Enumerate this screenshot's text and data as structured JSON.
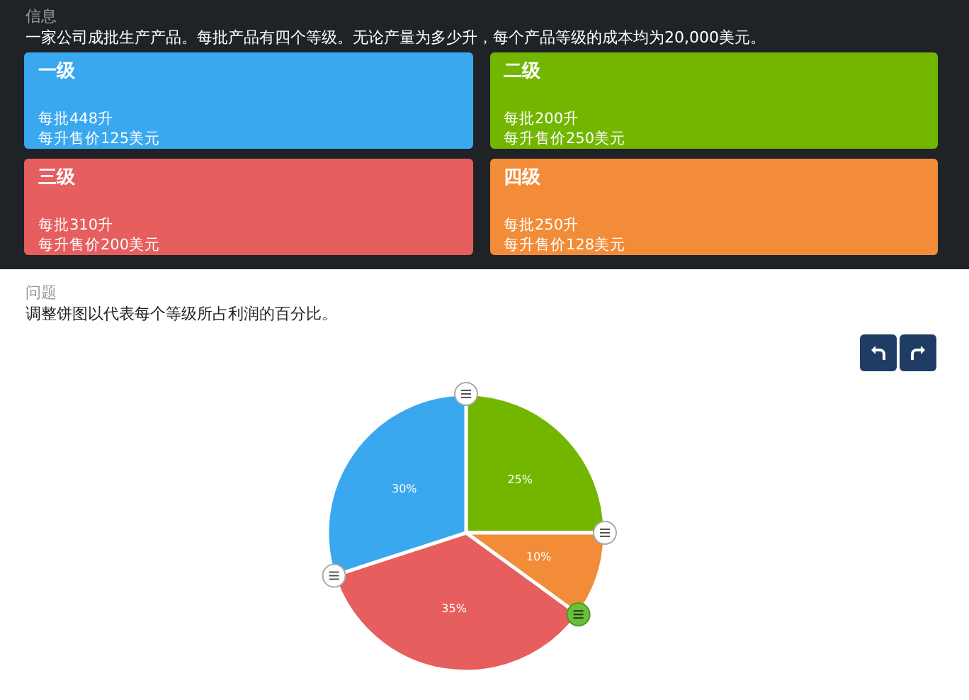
{
  "info": {
    "heading": "信息",
    "text": "一家公司成批生产产品。每批产品有四个等级。无论产量为多少升，每个产品等级的成本均为20,000美元。",
    "grades": [
      {
        "title": "一级",
        "batch": "每批448升",
        "price": "每升售价125美元",
        "color": "#3aa8ef"
      },
      {
        "title": "二级",
        "batch": "每批200升",
        "price": "每升售价250美元",
        "color": "#72b600"
      },
      {
        "title": "三级",
        "batch": "每批310升",
        "price": "每升售价200美元",
        "color": "#e65e5e"
      },
      {
        "title": "四级",
        "batch": "每批250升",
        "price": "每升售价128美元",
        "color": "#f28c38"
      }
    ]
  },
  "question": {
    "heading": "问题",
    "text": "调整饼图以代表每个等级所占利润的百分比。"
  },
  "toolbar": [
    {
      "kind": "undo"
    },
    {
      "kind": "redo"
    }
  ],
  "pie": {
    "chart_data": {
      "type": "pie",
      "values": [
        25,
        10,
        35,
        30
      ],
      "value_labels": [
        "25%",
        "10%",
        "35%",
        "30%"
      ],
      "colors": [
        "#72b600",
        "#f28c38",
        "#e65e5e",
        "#3aa8ef"
      ]
    },
    "handles": [
      {
        "selected": false
      },
      {
        "selected": false
      },
      {
        "selected": true
      },
      {
        "selected": false
      }
    ]
  }
}
